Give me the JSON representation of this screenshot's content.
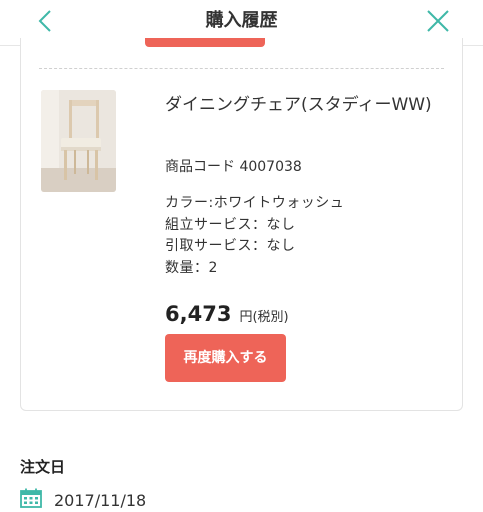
{
  "header": {
    "title": "購入履歴",
    "back_icon": "chevron-left-icon",
    "close_icon": "close-icon",
    "accent_color": "#3fb8a8"
  },
  "item": {
    "name": "ダイニングチェア(スタディーWW)",
    "code": "商品コード 4007038",
    "attributes": [
      "カラー:ホワイトウォッシュ",
      "組立サービス：なし",
      "引取サービス：なし",
      "数量：2"
    ],
    "price": "6,473",
    "price_unit": "円",
    "price_tax_note": "(税別)",
    "rebuy_label": "再度購入する",
    "button_color": "#ee6458"
  },
  "order": {
    "date_label": "注文日",
    "date_icon": "calendar-icon",
    "date": "2017/11/18"
  }
}
